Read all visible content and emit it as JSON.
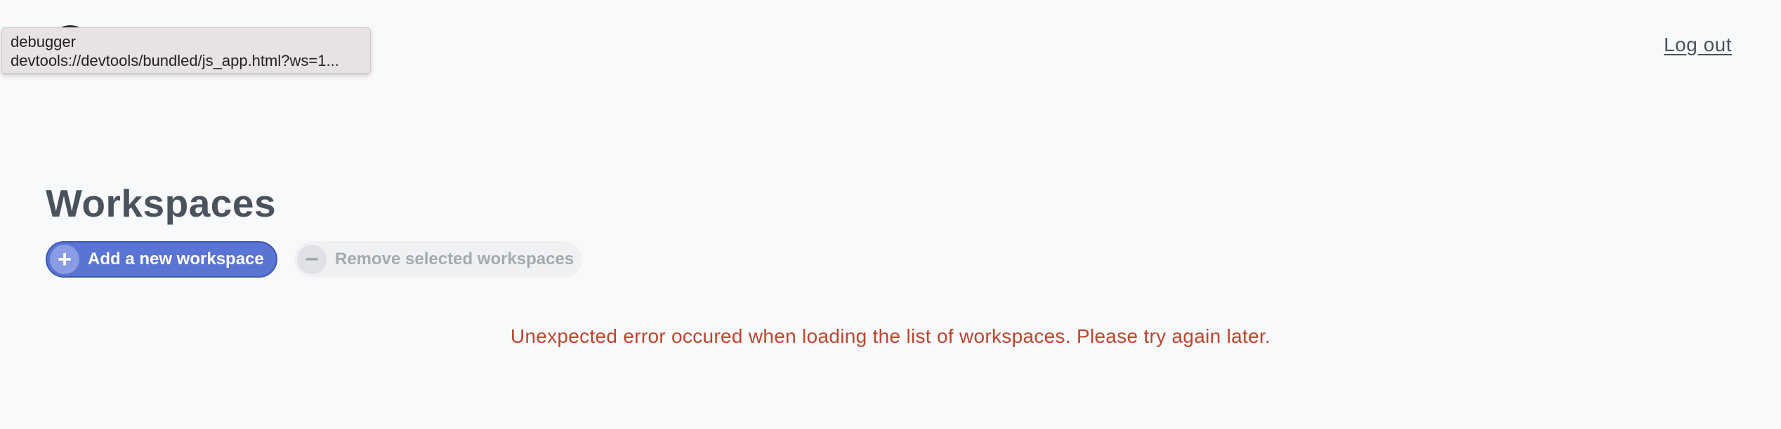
{
  "header": {
    "logout_label": "Log out"
  },
  "tooltip": {
    "line1": "debugger",
    "line2": "devtools://devtools/bundled/js_app.html?ws=1..."
  },
  "main": {
    "title": "Workspaces",
    "add_button": {
      "icon": "plus-icon",
      "icon_glyph": "+",
      "label": "Add a new workspace"
    },
    "remove_button": {
      "icon": "minus-icon",
      "icon_glyph": "−",
      "label": "Remove selected workspaces"
    },
    "error_message": "Unexpected error occured when loading the list of workspaces. Please try again later."
  },
  "colors": {
    "background": "#f8f9fb",
    "primary": "#5a74d4",
    "error": "#c0442d",
    "text": "#4a525d"
  }
}
